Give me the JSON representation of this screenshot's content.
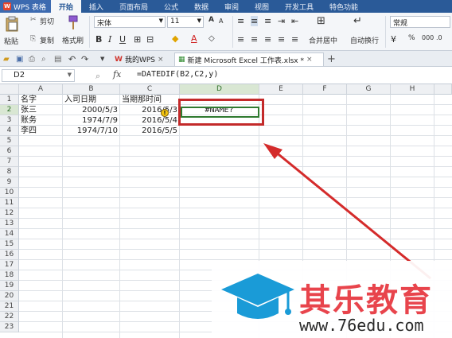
{
  "app": {
    "logo": "WPS 表格"
  },
  "menu": [
    "开始",
    "插入",
    "页面布局",
    "公式",
    "数据",
    "审阅",
    "视图",
    "开发工具",
    "特色功能"
  ],
  "ribbon": {
    "cut": "剪切",
    "paste": "粘贴",
    "copy": "复制",
    "format_painter": "格式刷",
    "font_name": "宋体",
    "font_size": "11",
    "merge_center": "合并居中",
    "wrap_text": "自动换行",
    "number_format": "常规",
    "percent": "%",
    "thousands": "000"
  },
  "tabs": [
    {
      "label": "我的WPS"
    },
    {
      "label": "新建 Microsoft Excel 工作表.xlsx *"
    }
  ],
  "formula_bar": {
    "name_box": "D2",
    "fx": "fx",
    "formula": "=DATEDIF(B2,C2,y)"
  },
  "columns": [
    "A",
    "B",
    "C",
    "D",
    "E",
    "F",
    "G",
    "H"
  ],
  "rows": [
    "1",
    "2",
    "3",
    "4",
    "5",
    "6",
    "7",
    "8",
    "9",
    "10",
    "11",
    "12",
    "13",
    "14",
    "15",
    "16",
    "17",
    "18",
    "19",
    "20",
    "21",
    "22",
    "23"
  ],
  "cells": {
    "A1": "名字",
    "B1": "入司日期",
    "C1": "当期那时间",
    "A2": "张三",
    "B2": "2000/5/3",
    "C2": "2016/5/3",
    "D2": "#NAME?",
    "A3": "账务",
    "B3": "1974/7/9",
    "C3": "2016/5/4",
    "A4": "李四",
    "B4": "1974/7/10",
    "C4": "2016/5/5"
  },
  "watermark": {
    "title": "其乐教育",
    "url": "www.76edu.com"
  },
  "colors": {
    "menubar": "#2a5a98",
    "highlight": "#c32a2a",
    "watermark": "#e8444c",
    "logo": "#1a9bd7"
  }
}
